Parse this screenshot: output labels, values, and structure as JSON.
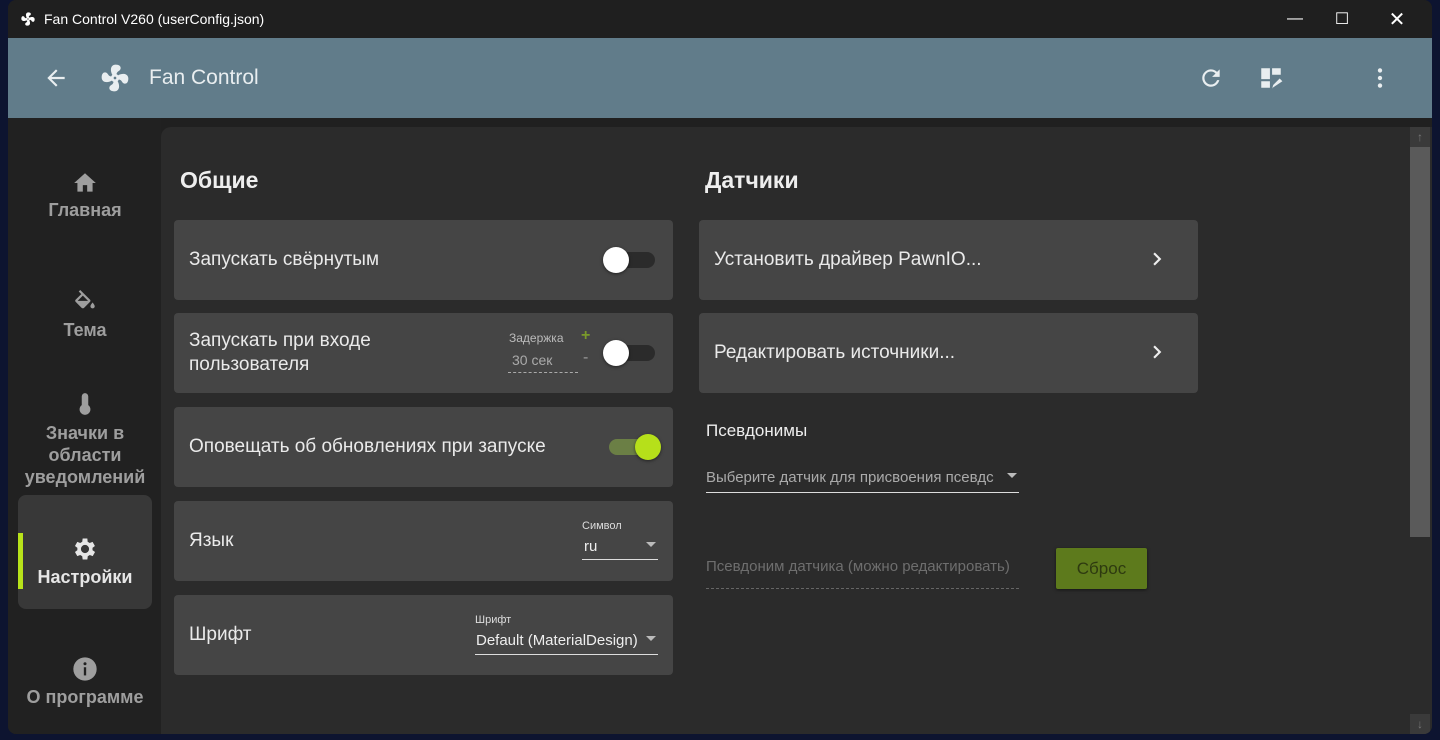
{
  "window": {
    "title": "Fan Control V260 (userConfig.json)"
  },
  "appbar": {
    "title": "Fan Control",
    "icons": [
      "back-arrow-icon",
      "fan-icon",
      "refresh-icon",
      "dashboard-edit-icon",
      "more-vert-icon"
    ]
  },
  "sidebar": {
    "items": [
      {
        "label": "Главная",
        "icon": "home-icon"
      },
      {
        "label": "Тема",
        "icon": "paint-bucket-icon"
      },
      {
        "label": "Значки в области уведомлений",
        "icon": "thermometer-icon"
      },
      {
        "label": "Настройки",
        "icon": "gear-icon",
        "active": true
      },
      {
        "label": "О программе",
        "icon": "info-icon"
      }
    ]
  },
  "general": {
    "title": "Общие",
    "start_minimized": {
      "label": "Запускать свёрнутым",
      "on": false
    },
    "start_login": {
      "label": "Запускать при входе пользователя",
      "delay_caption": "Задержка",
      "delay_value": "30 сек",
      "plus": "+",
      "minus": "-",
      "on": false
    },
    "notify_updates": {
      "label": "Оповещать об обновлениях при запуске",
      "on": true
    },
    "language": {
      "label": "Язык",
      "caption": "Символ",
      "value": "ru"
    },
    "font": {
      "label": "Шрифт",
      "caption": "Шрифт",
      "value": "Default (MaterialDesign)"
    }
  },
  "sensors": {
    "title": "Датчики",
    "install_driver": "Установить драйвер PawnIO...",
    "edit_sources": "Редактировать источники...",
    "aliases_title": "Псевдонимы",
    "sensor_select_placeholder": "Выберите датчик для присвоения псевдс",
    "alias_input_placeholder": "Псевдоним датчика (можно редактировать)",
    "reset_label": "Сброс"
  },
  "colors": {
    "accent": "#b6e01a",
    "appbar": "#617c8a",
    "card": "#454545"
  }
}
